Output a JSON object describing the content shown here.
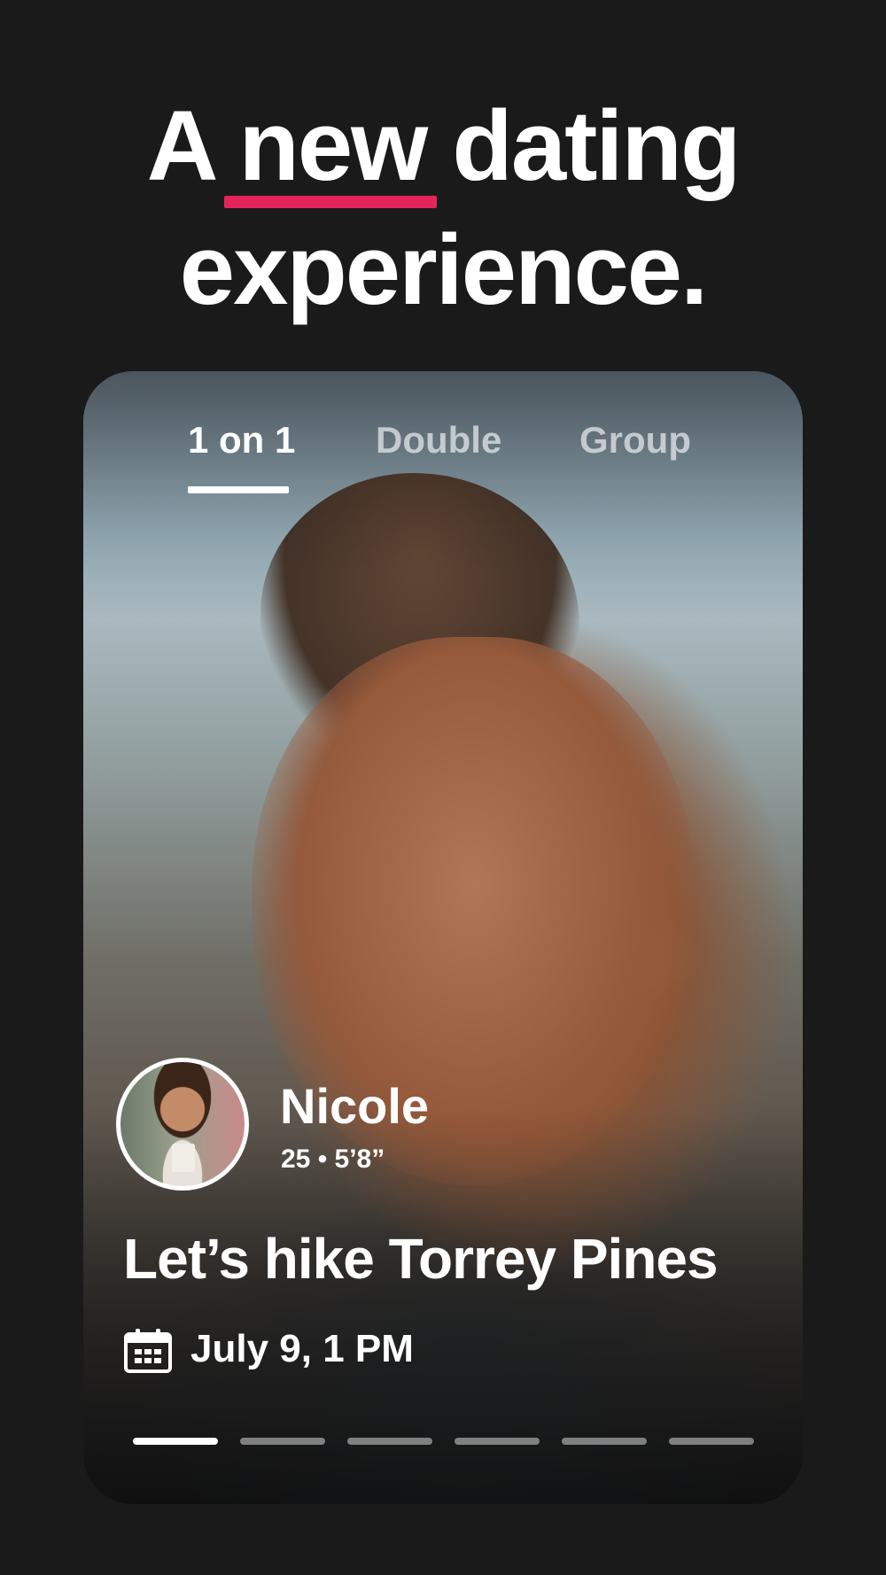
{
  "headline": {
    "line1": "A new dating",
    "line2": "experience.",
    "accent_color": "#e3245a"
  },
  "tabs": [
    {
      "label": "1 on 1",
      "active": true
    },
    {
      "label": "Double",
      "active": false
    },
    {
      "label": "Group",
      "active": false
    }
  ],
  "profile": {
    "name": "Nicole",
    "details": "25 • 5’8”",
    "activity": "Let’s hike Torrey Pines",
    "date": "July 9, 1 PM",
    "date_icon": "calendar-icon",
    "avatar_icon": "avatar"
  },
  "progress": {
    "total": 6,
    "current": 1
  },
  "colors": {
    "background": "#1a1a1a",
    "text": "#ffffff"
  }
}
